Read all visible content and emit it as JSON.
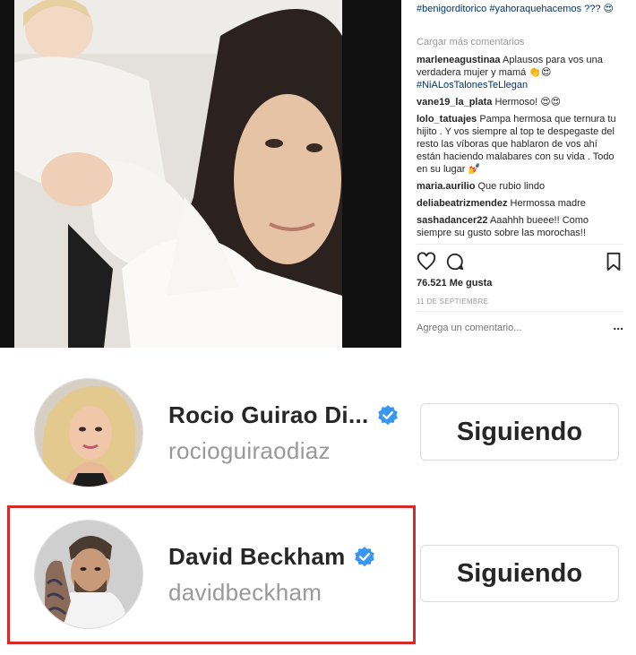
{
  "post": {
    "hashtags": "#benigorditorico #yahoraquehacemos ??? 😍",
    "load_more": "Cargar más comentarios",
    "comments": [
      {
        "user": "marleneagustinaa",
        "text": "Aplausos para vos una verdadera mujer y mamá 👏😍",
        "tag": "#NiALosTalonesTeLlegan"
      },
      {
        "user": "vane19_la_plata",
        "text": "Hermoso! 😍😍",
        "tag": ""
      },
      {
        "user": "lolo_tatuajes",
        "text": "Pampa hermosa que ternura tu hijito . Y vos siempre al top te despegaste del resto las víboras que hablaron de vos ahí están haciendo malabares con su vida . Todo en su lugar 💅",
        "tag": ""
      },
      {
        "user": "maria.aurilio",
        "text": "Que rubio lindo",
        "tag": ""
      },
      {
        "user": "deliabeatrizmendez",
        "text": "Hermossa madre",
        "tag": ""
      },
      {
        "user": "sashadancer22",
        "text": "Aaahhh bueee!! Como siempre su gusto sobre las morochas!!",
        "tag": ""
      }
    ],
    "likes": "76.521 Me gusta",
    "date": "11 DE SEPTIEMBRE",
    "add_comment_placeholder": "Agrega un comentario...",
    "more_label": "..."
  },
  "following": [
    {
      "name": "Rocio Guirao Di...",
      "handle": "rocioguiraodiaz",
      "button": "Siguiendo"
    },
    {
      "name": "David Beckham",
      "handle": "davidbeckham",
      "button": "Siguiendo"
    }
  ],
  "colors": {
    "verified": "#3897f0",
    "highlight": "#d42a2a",
    "link": "#003569"
  },
  "icons": [
    "heart-icon",
    "comment-icon",
    "bookmark-icon",
    "verified-badge-icon"
  ]
}
